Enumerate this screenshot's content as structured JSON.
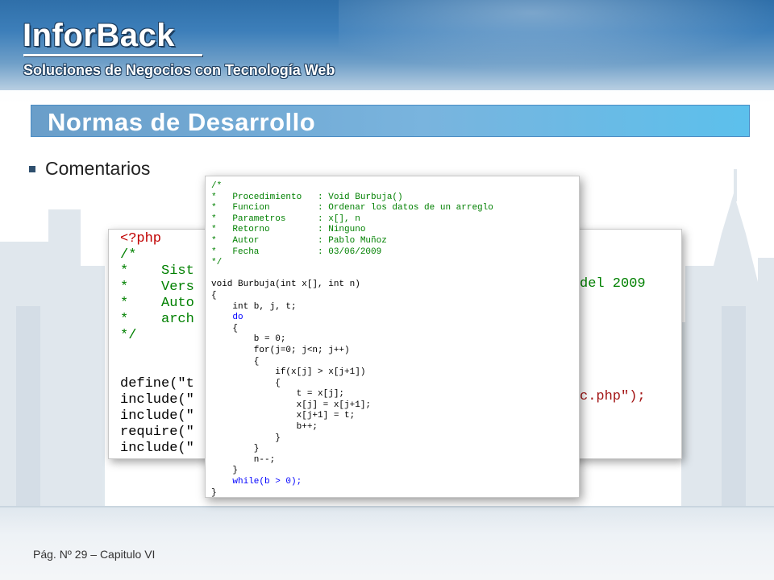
{
  "header": {
    "brand": "InforBack",
    "tagline": "Soluciones de Negocios con Tecnología Web"
  },
  "slide": {
    "title": "Normas de Desarrollo",
    "bullet": "Comentarios"
  },
  "back_code": {
    "lines": [
      "<?php",
      "/*",
      "*    Sist",
      "*    Vers",
      "*    Auto",
      "*    arch",
      "*/",
      "",
      "define(\"t",
      "include(\"",
      "include(\"",
      "require(\"",
      "include(\""
    ],
    "fragment_year": "del 2009",
    "fragment_call": "c.php\");"
  },
  "front_code": {
    "lines": [
      "/*",
      "*   Procedimiento   : Void Burbuja()",
      "*   Funcion         : Ordenar los datos de un arreglo",
      "*   Parametros      : x[], n",
      "*   Retorno         : Ninguno",
      "*   Autor           : Pablo Muñoz",
      "*   Fecha           : 03/06/2009",
      "*/",
      "",
      "void Burbuja(int x[], int n)",
      "{",
      "    int b, j, t;",
      "    do",
      "    {",
      "        b = 0;",
      "        for(j=0; j<n; j++)",
      "        {",
      "            if(x[j] > x[j+1])",
      "            {",
      "                t = x[j];",
      "                x[j] = x[j+1];",
      "                x[j+1] = t;",
      "                b++;",
      "            }",
      "        }",
      "        n--;",
      "    }",
      "    while(b > 0);",
      "}"
    ]
  },
  "footer": {
    "page_label": "Pág. Nº 29 – Capitulo VI"
  },
  "colors": {
    "header_blue": "#3d7fba",
    "title_bar": "#79b4de",
    "comment_green": "#008000",
    "keyword_blue": "#0000ff"
  }
}
